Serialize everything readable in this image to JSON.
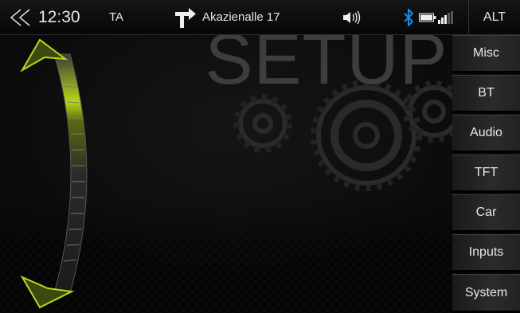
{
  "status_bar": {
    "clock": "12:30",
    "ta": "TA",
    "street": "Akazienalle 17",
    "alt_label": "ALT",
    "icons": {
      "back": "double-chevron-left-icon",
      "turn": "turn-right-arrow-icon",
      "volume": "speaker-icon",
      "bluetooth": "bluetooth-icon",
      "battery": "battery-icon",
      "signal": "signal-strength-icon"
    },
    "bluetooth_color": "#1e88e5"
  },
  "background_title": "SETUP",
  "side_menu": {
    "items": [
      {
        "label": "Misc"
      },
      {
        "label": "BT"
      },
      {
        "label": "Audio"
      },
      {
        "label": "TFT"
      },
      {
        "label": "Car"
      },
      {
        "label": "Inputs"
      },
      {
        "label": "System"
      }
    ]
  },
  "scroll_wheel": {
    "accent_color": "#b8d817",
    "up_icon": "arrow-up-icon",
    "down_icon": "arrow-down-icon"
  }
}
